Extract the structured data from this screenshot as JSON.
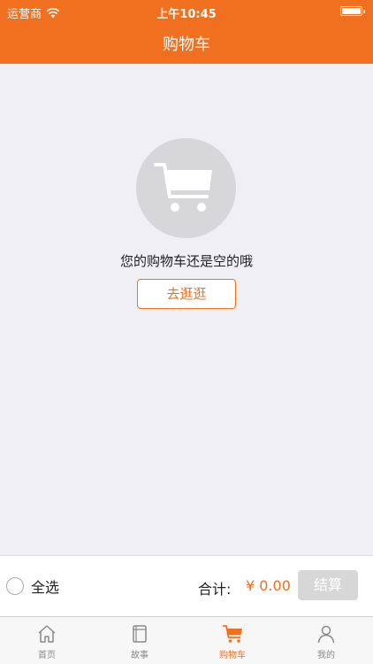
{
  "status_bar": {
    "carrier": "运营商",
    "time": "上午10:45"
  },
  "nav": {
    "title": "购物车"
  },
  "empty_state": {
    "message": "您的购物车还是空的哦",
    "button_label": "去逛逛"
  },
  "footer": {
    "select_all_label": "全选",
    "total_label": "合计:",
    "total_amount": "¥ 0.00",
    "checkout_label": "结算"
  },
  "tabbar": {
    "items": [
      {
        "label": "首页",
        "icon": "home-icon",
        "active": false
      },
      {
        "label": "故事",
        "icon": "book-icon",
        "active": false
      },
      {
        "label": "购物车",
        "icon": "cart-icon",
        "active": true
      },
      {
        "label": "我的",
        "icon": "person-icon",
        "active": false
      }
    ]
  },
  "colors": {
    "accent": "#f07020",
    "background": "#efeff4",
    "disabled_button": "#d7d7d7",
    "inactive_tab": "#8a8a8a"
  }
}
